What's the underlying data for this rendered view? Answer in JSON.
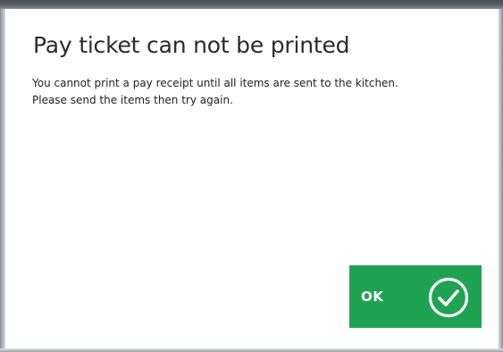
{
  "dialog": {
    "title": "Pay ticket can not be printed",
    "message_line1": "You cannot print a pay receipt until all items are sent to the kitchen.",
    "message_line2": "Please send the items then try again.",
    "ok_label": "OK",
    "ok_icon": "checkmark-circle-icon"
  },
  "colors": {
    "ok_button": "#1fa352",
    "title_text": "#2b2b2b",
    "frame": "#5b6066"
  }
}
